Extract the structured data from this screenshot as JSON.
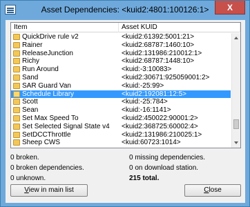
{
  "window": {
    "title": "Asset Dependencies: <kuid2:4801:100126:1>",
    "close_label": "X"
  },
  "list": {
    "columns": [
      "Item",
      "Asset KUID"
    ],
    "rows": [
      {
        "name": "QuickDrive rule v2",
        "kuid": "<kuid2:61392:5001:21>"
      },
      {
        "name": "Rainer",
        "kuid": "<kuid2:68787:1460:10>"
      },
      {
        "name": "ReleaseJunction",
        "kuid": "<kuid2:131986:210012:1>"
      },
      {
        "name": "Richy",
        "kuid": "<kuid2:68787:1448:10>"
      },
      {
        "name": "Run Around",
        "kuid": "<kuid:-3:10083>"
      },
      {
        "name": "Sand",
        "kuid": "<kuid2:30671:925059001:2>"
      },
      {
        "name": "SAR Guard Van",
        "kuid": "<kuid:-25:99>"
      },
      {
        "name": "Schedule Library",
        "kuid": "<kuid2:192081:12:5>",
        "selected": true
      },
      {
        "name": "Scott",
        "kuid": "<kuid:-25:784>"
      },
      {
        "name": "Sean",
        "kuid": "<kuid:-16:1141>"
      },
      {
        "name": "Set Max Speed To",
        "kuid": "<kuid2:450022:90001:2>"
      },
      {
        "name": "Set Selected Signal State v4",
        "kuid": "<kuid2:368725:60002:4>"
      },
      {
        "name": "SetDCCThrottle",
        "kuid": "<kuid2:131986:210025:1>"
      },
      {
        "name": "Sheep CWS",
        "kuid": "<kuid:60723:1014>"
      }
    ]
  },
  "stats": {
    "broken": "0 broken.",
    "missing": "0 missing dependencies.",
    "broken_deps": "0 broken dependencies.",
    "on_download": "0 on download station.",
    "unknown": "0 unknown.",
    "total": "215 total."
  },
  "buttons": {
    "view_prefix": "V",
    "view_rest": "iew in main list",
    "close_prefix": "C",
    "close_rest": "lose"
  },
  "colors": {
    "title_bar": "#6fa9dc",
    "selection": "#3399ff",
    "close_red": "#c7504a"
  },
  "icons": {
    "app": "app-icon",
    "row": "folder-icon"
  }
}
